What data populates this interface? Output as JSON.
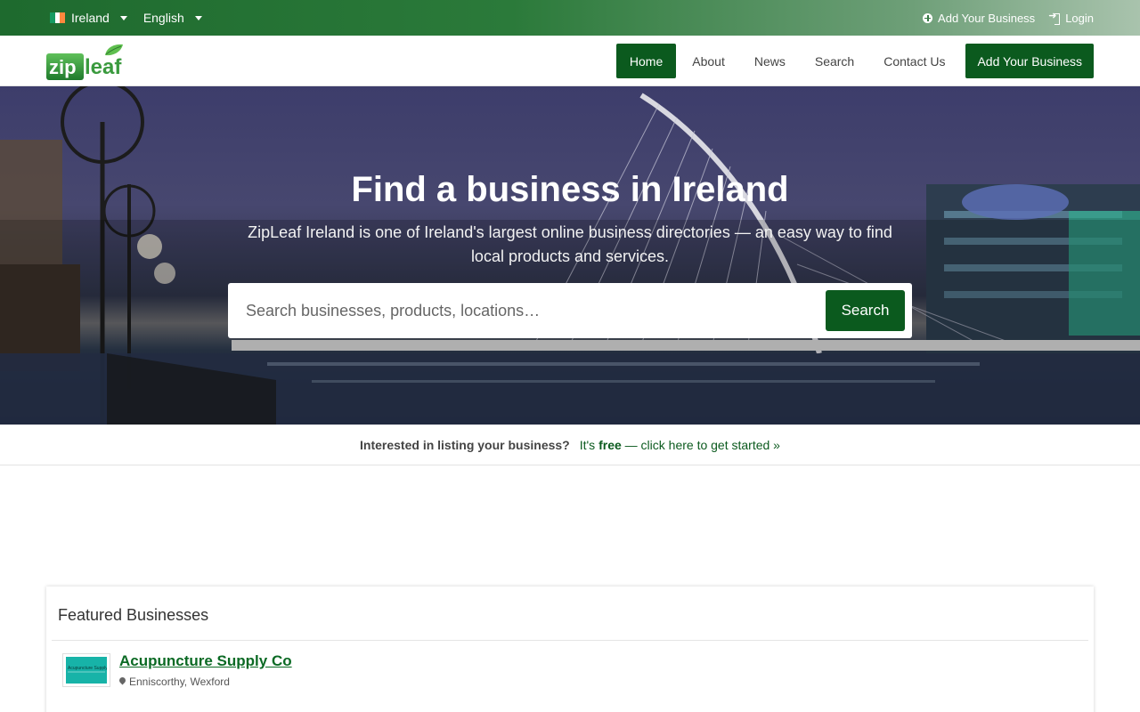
{
  "topbar": {
    "country": "Ireland",
    "language": "English",
    "add_business": "Add Your Business",
    "login": "Login"
  },
  "nav": {
    "logo_text": "zipleaf",
    "items": [
      "Home",
      "About",
      "News",
      "Search",
      "Contact Us"
    ],
    "active": "Home",
    "cta": "Add Your Business"
  },
  "hero": {
    "title": "Find a business in Ireland",
    "subtitle": "ZipLeaf Ireland is one of Ireland's largest online business directories — an easy way to find local products and services.",
    "search_placeholder": "Search businesses, products, locations…",
    "search_button": "Search"
  },
  "promo": {
    "question": "Interested in listing your business?",
    "prefix": "It's",
    "free": "free",
    "suffix": "— click here to get started »"
  },
  "featured": {
    "heading": "Featured Businesses",
    "items": [
      {
        "name": "Acupuncture Supply Co",
        "location": "Enniscorthy, Wexford",
        "logo_text": "Acupuncture Supply Co"
      }
    ]
  },
  "colors": {
    "brand_green": "#0b5a1e",
    "topbar_green": "#1e6a2e",
    "link_green": "#0b6a24"
  },
  "icons": {
    "add_business": "plus-circle-icon",
    "login": "sign-in-icon",
    "location": "map-marker-icon"
  }
}
